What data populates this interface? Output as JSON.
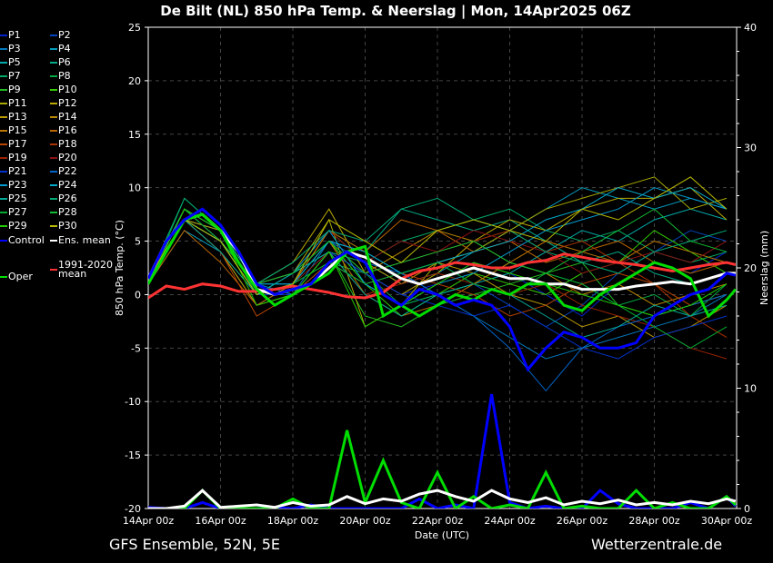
{
  "title": "De Bilt  (NL)  850 hPa Temp. & Neerslag | Mon, 14Apr2025 06Z",
  "footer_left": "GFS Ensemble, 52N, 5E",
  "footer_right": "Wetterzentrale.de",
  "chart_data": {
    "type": "line",
    "xlabel": "Date (UTC)",
    "ylabel": "850 hPa Temp. (°C)",
    "y2label": "Neerslag (mm)",
    "ylim": [
      -20,
      25
    ],
    "y2lim": [
      0,
      40
    ],
    "yticks": [
      "25",
      "20",
      "15",
      "10",
      "5",
      "0",
      "-5",
      "-10",
      "-15",
      "-20"
    ],
    "y2ticks": [
      "40",
      "30",
      "20",
      "10",
      "0"
    ],
    "xticks": [
      "14Apr 00z",
      "16Apr 00z",
      "18Apr 00z",
      "20Apr 00z",
      "22Apr 00z",
      "24Apr 00z",
      "26Apr 00z",
      "28Apr 00z",
      "30Apr 00z"
    ],
    "grid": true,
    "legend_position": "left-outside",
    "x_days_halfdaily": [
      0,
      0.5,
      1,
      1.5,
      2,
      2.5,
      3,
      3.5,
      4,
      4.5,
      5,
      5.5,
      6,
      6.5,
      7,
      7.5,
      8,
      8.5,
      9,
      9.5,
      10,
      10.5,
      11,
      11.5,
      12,
      12.5,
      13,
      13.5,
      14,
      14.5,
      15,
      15.5,
      16,
      16.25
    ],
    "main_series": [
      {
        "name": "Control",
        "color": "#0000ff",
        "width": 3,
        "temp": [
          1.5,
          5,
          7,
          8,
          6.5,
          4,
          1,
          0,
          0.5,
          1,
          3,
          4,
          3,
          0,
          -1,
          0.5,
          0,
          -1,
          -0.5,
          -1,
          -3,
          -7,
          -5,
          -3.5,
          -4,
          -5,
          -5,
          -4.5,
          -2,
          -1,
          0,
          0.5,
          2,
          1.8
        ],
        "precip": [
          0.1,
          0,
          0,
          0.5,
          0,
          0,
          0,
          0.1,
          0,
          0.3,
          0,
          0,
          0,
          0,
          0,
          0.8,
          0,
          0.3,
          0,
          9.5,
          0.5,
          0,
          0.2,
          0,
          0,
          1.5,
          0.4,
          0,
          0,
          0,
          0.5,
          0,
          1,
          0.2
        ]
      },
      {
        "name": "Oper",
        "color": "#00dd00",
        "width": 3,
        "temp": [
          1,
          4,
          7,
          7.5,
          6,
          3,
          0.5,
          -1,
          0,
          1,
          2,
          4,
          4.5,
          -2,
          -1,
          -2,
          -1,
          0,
          -0.5,
          0.5,
          0,
          1,
          1,
          -1,
          -1.5,
          0,
          1,
          2,
          3,
          2.5,
          1.5,
          -2,
          -0.5,
          0.5
        ],
        "precip": [
          0,
          0,
          0,
          1.5,
          0,
          0,
          0,
          0,
          0.8,
          0,
          0,
          6.5,
          0.5,
          4,
          0.5,
          0,
          3,
          0,
          1,
          0,
          0.3,
          0,
          3,
          0,
          0.2,
          0,
          0,
          1.5,
          0,
          0.5,
          0,
          0,
          1,
          0.3
        ]
      },
      {
        "name": "Ens. mean",
        "color": "#ffffff",
        "width": 3,
        "temp": [
          1.5,
          5,
          7,
          7.5,
          6,
          4,
          0.5,
          0,
          0.5,
          1,
          2.5,
          4,
          3.5,
          2.5,
          1.5,
          1,
          1.5,
          2,
          2.5,
          2,
          1.5,
          1.5,
          1,
          1,
          0.5,
          0.5,
          0.5,
          0.8,
          1,
          1.2,
          1,
          1.5,
          2,
          2
        ],
        "precip": [
          0,
          0,
          0.2,
          1.5,
          0.1,
          0.2,
          0.3,
          0.1,
          0.5,
          0.2,
          0.3,
          1,
          0.4,
          0.8,
          0.6,
          1.2,
          1.5,
          1,
          0.6,
          1.5,
          0.8,
          0.5,
          0.9,
          0.3,
          0.6,
          0.4,
          0.7,
          0.3,
          0.5,
          0.3,
          0.6,
          0.4,
          0.8,
          0.6
        ]
      },
      {
        "name": "1991-2020 mean",
        "color": "#ff3333",
        "width": 3,
        "temp": [
          -0.3,
          0.8,
          0.5,
          1,
          0.8,
          0.3,
          0.3,
          0.5,
          0.8,
          0.5,
          0.2,
          -0.2,
          -0.3,
          0.2,
          1.5,
          2.2,
          2.5,
          3,
          2.8,
          2.5,
          2.5,
          3,
          3.2,
          3.8,
          3.5,
          3.2,
          3,
          2.8,
          2.5,
          2.2,
          2.5,
          2.8,
          3,
          2.8
        ]
      }
    ],
    "x_days_daily": [
      0,
      1,
      2,
      3,
      4,
      5,
      6,
      7,
      8,
      9,
      10,
      11,
      12,
      13,
      14,
      15,
      16
    ],
    "members": [
      {
        "name": "P1",
        "color": "#0022cc",
        "temp": [
          1,
          7,
          5,
          0,
          1,
          4,
          2,
          0,
          1,
          3,
          2,
          0,
          -2,
          1,
          3,
          2,
          4
        ]
      },
      {
        "name": "P2",
        "color": "#0044bb",
        "temp": [
          1.5,
          8,
          5,
          1,
          0,
          3,
          1,
          2,
          3,
          1,
          -1,
          -3,
          -1,
          2,
          4,
          6,
          5
        ]
      },
      {
        "name": "P3",
        "color": "#0077bb",
        "temp": [
          1,
          7,
          6,
          1,
          0,
          5,
          4,
          2,
          0,
          -2,
          -4,
          -6,
          -5,
          -4,
          -3,
          -2,
          0
        ]
      },
      {
        "name": "P4",
        "color": "#0099bb",
        "temp": [
          1,
          6,
          4,
          -1,
          1,
          6,
          3,
          1,
          2,
          4,
          6,
          8,
          10,
          9,
          8,
          9,
          8
        ]
      },
      {
        "name": "P5",
        "color": "#00aaaa",
        "temp": [
          1,
          8,
          6,
          0,
          2,
          5,
          1,
          -1,
          0,
          1,
          2,
          4,
          6,
          5,
          7,
          8,
          7
        ]
      },
      {
        "name": "P6",
        "color": "#00aa88",
        "temp": [
          1.5,
          7,
          5,
          1,
          2,
          6,
          4,
          8,
          7,
          6,
          7,
          5,
          3,
          4,
          2,
          1,
          2
        ]
      },
      {
        "name": "P7",
        "color": "#00aa66",
        "temp": [
          1,
          8,
          6,
          1,
          2,
          4,
          3,
          5,
          6,
          7,
          8,
          6,
          5,
          6,
          4,
          3,
          4
        ]
      },
      {
        "name": "P8",
        "color": "#00aa44",
        "temp": [
          1,
          9,
          6,
          0,
          1,
          3,
          2,
          -1,
          0,
          1,
          3,
          2,
          1,
          -1,
          0,
          -2,
          1
        ]
      },
      {
        "name": "P9",
        "color": "#22bb22",
        "temp": [
          1,
          7,
          4,
          -1,
          0,
          4,
          -2,
          -3,
          -1,
          0,
          1,
          2,
          3,
          -1,
          -2,
          -1,
          0
        ]
      },
      {
        "name": "P10",
        "color": "#33cc00",
        "temp": [
          1.5,
          8,
          5,
          0,
          1,
          5,
          1,
          -2,
          0,
          2,
          1,
          0,
          2,
          3,
          6,
          4,
          2
        ]
      },
      {
        "name": "P11",
        "color": "#aaaa00",
        "temp": [
          1,
          7,
          5,
          1,
          2,
          7,
          -3,
          -1,
          3,
          4,
          6,
          8,
          9,
          10,
          11,
          8,
          9
        ]
      },
      {
        "name": "P12",
        "color": "#bbaa00",
        "temp": [
          1,
          7,
          6,
          1,
          3,
          8,
          2,
          0,
          2,
          5,
          7,
          6,
          8,
          9,
          9,
          10,
          7
        ]
      },
      {
        "name": "P13",
        "color": "#bb9900",
        "temp": [
          1,
          8,
          5,
          0,
          1,
          6,
          3,
          1,
          3,
          2,
          0,
          -1,
          -3,
          -2,
          -4,
          -3,
          -1
        ]
      },
      {
        "name": "P14",
        "color": "#bb8800",
        "temp": [
          1.5,
          7,
          4,
          -1,
          0,
          4,
          2,
          4,
          6,
          5,
          3,
          2,
          0,
          1,
          -1,
          0,
          1
        ]
      },
      {
        "name": "P15",
        "color": "#bb7700",
        "temp": [
          1,
          8,
          5,
          0,
          1,
          5,
          0,
          -2,
          -1,
          1,
          3,
          5,
          4,
          3,
          5,
          4,
          3
        ]
      },
      {
        "name": "P16",
        "color": "#bb6600",
        "temp": [
          1,
          6,
          3,
          -1,
          1,
          6,
          4,
          7,
          6,
          4,
          5,
          3,
          4,
          5,
          3,
          2,
          3
        ]
      },
      {
        "name": "P17",
        "color": "#bb4400",
        "temp": [
          1,
          7,
          4,
          -2,
          0,
          3,
          1,
          2,
          1,
          0,
          -2,
          -1,
          1,
          2,
          1,
          -1,
          0
        ]
      },
      {
        "name": "P18",
        "color": "#aa3300",
        "temp": [
          1.5,
          8,
          5,
          0,
          1,
          5,
          2,
          3,
          4,
          5,
          6,
          4,
          5,
          3,
          1,
          -2,
          -4
        ]
      },
      {
        "name": "P19",
        "color": "#992200",
        "temp": [
          1,
          7,
          4,
          0,
          1,
          4,
          0,
          1,
          2,
          1,
          0,
          1,
          -1,
          -2,
          -3,
          -5,
          -6
        ]
      },
      {
        "name": "P20",
        "color": "#881111",
        "temp": [
          1,
          8,
          5,
          1,
          2,
          6,
          3,
          5,
          4,
          6,
          5,
          4,
          2,
          3,
          4,
          3,
          5
        ]
      },
      {
        "name": "P21",
        "color": "#0033cc",
        "temp": [
          1,
          7,
          5,
          0,
          0,
          4,
          2,
          0,
          -1,
          -2,
          -1,
          -3,
          -5,
          -6,
          -4,
          -3,
          -2
        ]
      },
      {
        "name": "P22",
        "color": "#0066cc",
        "temp": [
          1.5,
          8,
          6,
          1,
          1,
          5,
          3,
          2,
          0,
          -2,
          -5,
          -9,
          -5,
          -3,
          -2,
          -1,
          0
        ]
      },
      {
        "name": "P23",
        "color": "#0099cc",
        "temp": [
          1,
          7,
          5,
          0,
          2,
          6,
          1,
          -1,
          1,
          2,
          4,
          6,
          7,
          8,
          10,
          9,
          8
        ]
      },
      {
        "name": "P24",
        "color": "#00aacc",
        "temp": [
          1,
          8,
          5,
          1,
          1,
          5,
          4,
          2,
          3,
          4,
          5,
          7,
          8,
          10,
          9,
          10,
          8
        ]
      },
      {
        "name": "P25",
        "color": "#00aa99",
        "temp": [
          1,
          7,
          4,
          0,
          2,
          4,
          0,
          -2,
          0,
          1,
          0,
          -2,
          -4,
          -3,
          -1,
          -2,
          -1
        ]
      },
      {
        "name": "P26",
        "color": "#00aa77",
        "temp": [
          1.5,
          9,
          6,
          1,
          3,
          6,
          5,
          8,
          9,
          7,
          6,
          4,
          3,
          2,
          4,
          5,
          6
        ]
      },
      {
        "name": "P27",
        "color": "#00aa33",
        "temp": [
          1,
          8,
          5,
          0,
          1,
          3,
          1,
          2,
          3,
          1,
          0,
          2,
          1,
          -1,
          -3,
          -5,
          -3
        ]
      },
      {
        "name": "P28",
        "color": "#11bb33",
        "temp": [
          1,
          7,
          5,
          1,
          2,
          5,
          2,
          3,
          4,
          5,
          3,
          2,
          4,
          6,
          8,
          5,
          4
        ]
      },
      {
        "name": "P29",
        "color": "#22cc00",
        "temp": [
          1,
          8,
          6,
          -1,
          0,
          4,
          -3,
          -1,
          1,
          3,
          2,
          1,
          0,
          -1,
          -2,
          -1,
          1
        ]
      },
      {
        "name": "P30",
        "color": "#bbbb00",
        "temp": [
          1.5,
          7,
          5,
          0,
          1,
          7,
          5,
          3,
          6,
          7,
          6,
          5,
          8,
          7,
          9,
          11,
          8
        ]
      }
    ]
  }
}
